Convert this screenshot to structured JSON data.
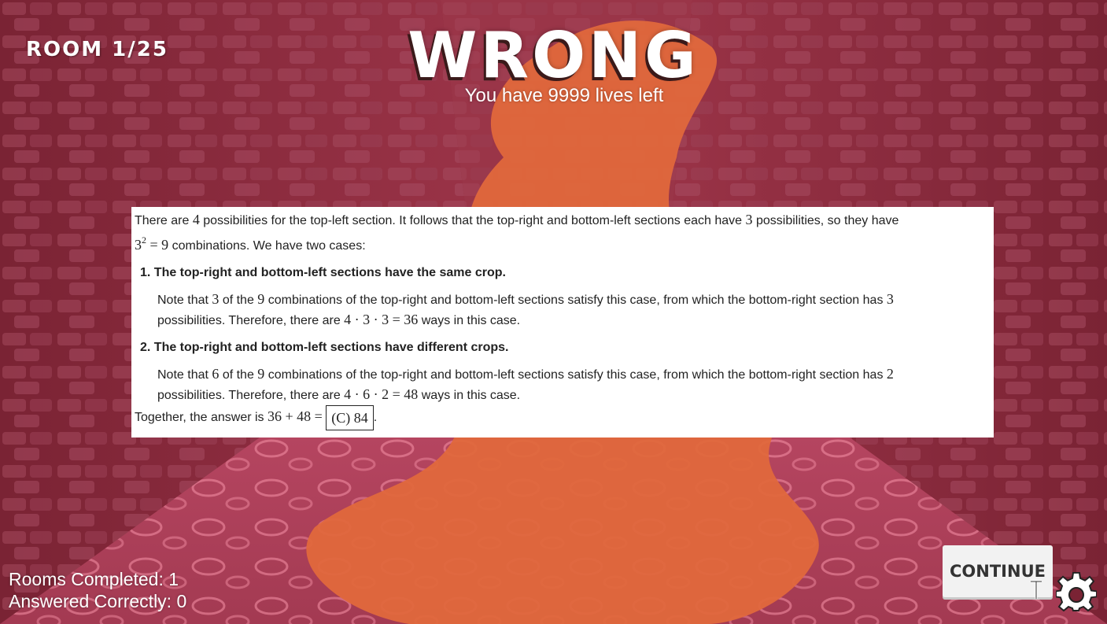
{
  "hud": {
    "room": "ROOM 1/25"
  },
  "result": {
    "title": "WRONG",
    "lives": "You have 9999 lives left"
  },
  "solution": {
    "intro_a": "There are ",
    "intro_n1": "4",
    "intro_b": " possibilities for the top-left section. It follows that the top-right and bottom-left sections each have ",
    "intro_n2": "3",
    "intro_c": " possibilities, so they have",
    "intro_math_base": "3",
    "intro_math_exp": "2",
    "intro_math_rest": " = 9",
    "intro_d": " combinations. We have two cases:",
    "cases": [
      {
        "title": "1. The top-right and bottom-left sections have the same crop.",
        "a": "Note that ",
        "n1": "3",
        "b": " of the ",
        "n2": "9",
        "c": " combinations of the top-right and bottom-left sections satisfy this case, from which the bottom-right section has ",
        "n3": "3",
        "d": "possibilities. Therefore, there are ",
        "math": "4 · 3 · 3 = 36",
        "e": " ways in this case."
      },
      {
        "title": "2. The top-right and bottom-left sections have different crops.",
        "a": "Note that ",
        "n1": "6",
        "b": " of the ",
        "n2": "9",
        "c": " combinations of the top-right and bottom-left sections satisfy this case, from which the bottom-right section has ",
        "n3": "2",
        "d": "possibilities. Therefore, there are ",
        "math": "4 · 6 · 2 = 48",
        "e": " ways in this case."
      }
    ],
    "together_text": "Together, the answer is ",
    "together_math": "36 + 48 = ",
    "answer": "(C) 84",
    "end": "."
  },
  "stats": {
    "rooms_completed": "Rooms Completed: 1",
    "answered_correctly": "Answered Correctly: 0"
  },
  "controls": {
    "continue_label": "CONTINUE"
  },
  "colors": {
    "wall_tint": "#8a2a3a",
    "lava": "#e0683c",
    "floor": "#c0506a"
  },
  "icons": [
    "gear-icon",
    "text-cursor-icon"
  ]
}
